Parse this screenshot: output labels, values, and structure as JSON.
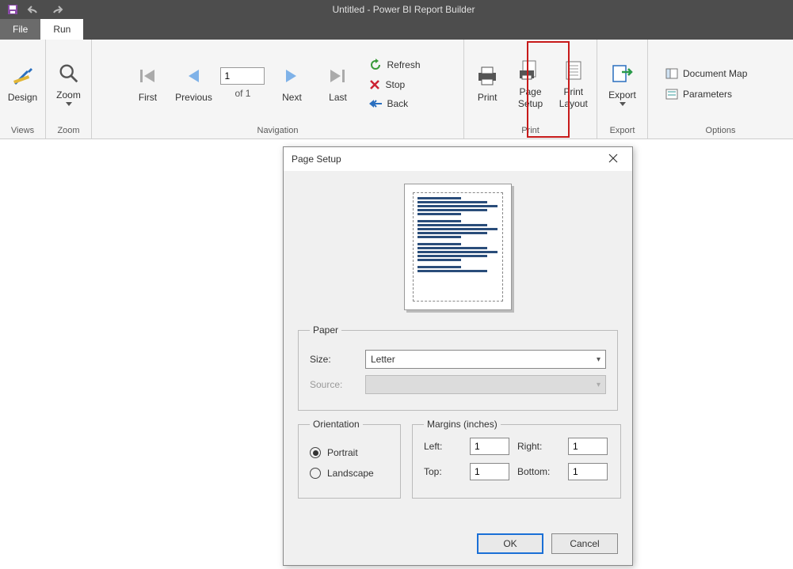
{
  "titlebar": {
    "title": "Untitled - Power BI Report Builder"
  },
  "tabs": {
    "file": "File",
    "run": "Run"
  },
  "ribbon": {
    "views": {
      "label": "Views",
      "design": "Design"
    },
    "zoom": {
      "label": "Zoom",
      "zoom": "Zoom"
    },
    "navigation": {
      "label": "Navigation",
      "first": "First",
      "previous": "Previous",
      "next": "Next",
      "last": "Last",
      "page_value": "1",
      "page_of": "of  1",
      "refresh": "Refresh",
      "stop": "Stop",
      "back": "Back"
    },
    "print": {
      "label": "Print",
      "print": "Print",
      "page_setup_line1": "Page",
      "page_setup_line2": "Setup",
      "print_layout_line1": "Print",
      "print_layout_line2": "Layout"
    },
    "export": {
      "label": "Export",
      "export": "Export"
    },
    "options": {
      "label": "Options",
      "document_map": "Document Map",
      "parameters": "Parameters"
    }
  },
  "dialog": {
    "title": "Page Setup",
    "paper": {
      "legend": "Paper",
      "size_label": "Size:",
      "size_value": "Letter",
      "source_label": "Source:"
    },
    "orientation": {
      "legend": "Orientation",
      "portrait": "Portrait",
      "landscape": "Landscape",
      "selected": "portrait"
    },
    "margins": {
      "legend": "Margins (inches)",
      "left_label": "Left:",
      "right_label": "Right:",
      "top_label": "Top:",
      "bottom_label": "Bottom:",
      "left": "1",
      "right": "1",
      "top": "1",
      "bottom": "1"
    },
    "buttons": {
      "ok": "OK",
      "cancel": "Cancel"
    }
  }
}
